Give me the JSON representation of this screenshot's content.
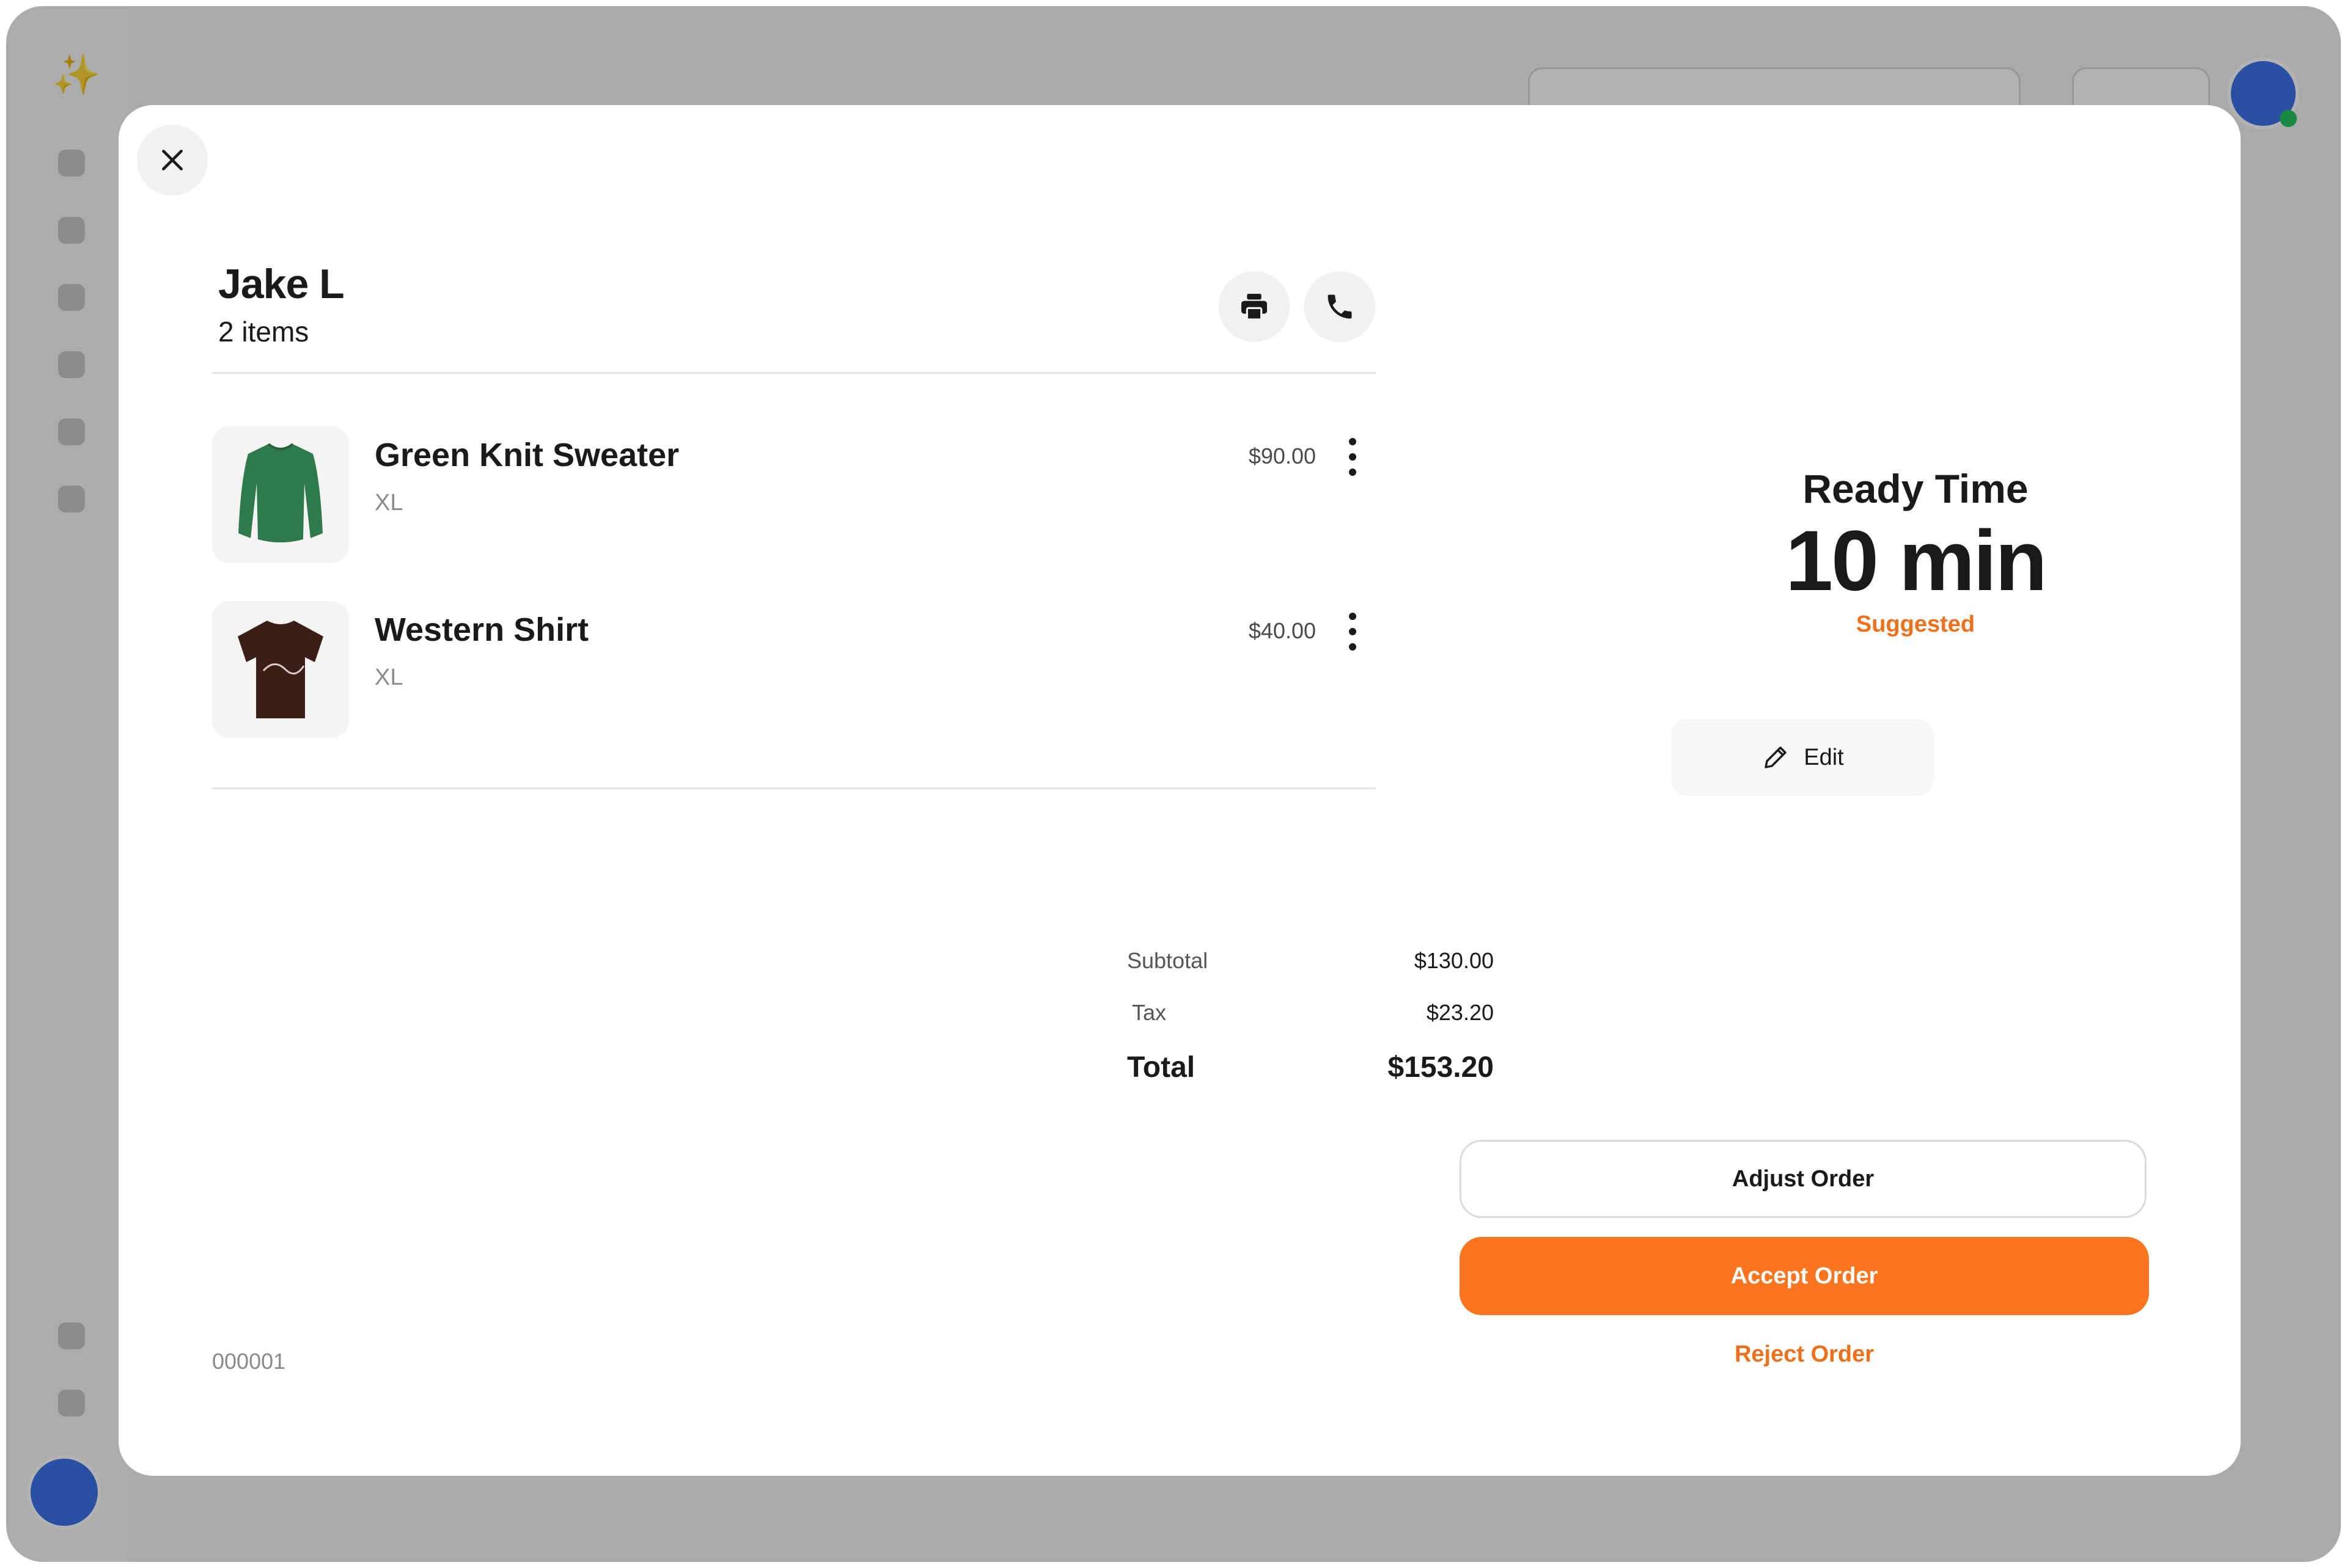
{
  "modal": {
    "customer": {
      "name": "Jake L",
      "item_count": "2 items"
    },
    "items": [
      {
        "name": "Green Knit Sweater",
        "variant": "XL",
        "price": "$90.00",
        "thumb_icon": "sweater-image"
      },
      {
        "name": "Western Shirt",
        "variant": "XL",
        "price": "$40.00",
        "thumb_icon": "shirt-image"
      }
    ],
    "totals": {
      "subtotal_label": "Subtotal",
      "subtotal": "$130.00",
      "tax_label": "Tax",
      "tax": "$23.20",
      "total_label": "Total",
      "total": "$153.20"
    },
    "order_id": "000001",
    "ready_time": {
      "title": "Ready Time",
      "value": "10 min",
      "note": "Suggested"
    },
    "edit_label": "Edit",
    "actions": {
      "adjust": "Adjust Order",
      "accept": "Accept Order",
      "reject": "Reject Order"
    },
    "icons": {
      "close": "close-icon",
      "print": "printer-icon",
      "call": "phone-icon",
      "more": "more-vertical-icon",
      "edit": "pencil-icon"
    }
  },
  "colors": {
    "accent": "#ff741f",
    "accent_text": "#f0701a",
    "sweater": "#2f7a4a",
    "shirt": "#3b1e16"
  }
}
